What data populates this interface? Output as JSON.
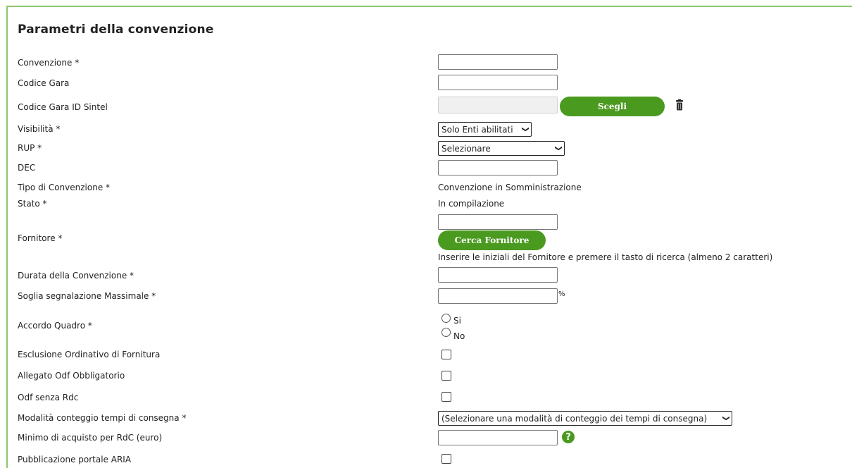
{
  "section": {
    "title": "Parametri della convenzione"
  },
  "labels": {
    "convenzione": "Convenzione *",
    "codice_gara": "Codice Gara",
    "codice_gara_sintel": "Codice Gara ID Sintel",
    "visibilita": "Visibilità *",
    "rup": "RUP *",
    "dec": "DEC",
    "tipo": "Tipo di Convenzione *",
    "stato": "Stato *",
    "fornitore": "Fornitore *",
    "durata": "Durata della Convenzione *",
    "soglia": "Soglia segnalazione Massimale *",
    "accordo": "Accordo Quadro *",
    "esclusione": "Esclusione Ordinativo di Fornitura",
    "allegato": "Allegato Odf Obbligatorio",
    "odf_rdc": "Odf senza Rdc",
    "modalita": "Modalità conteggio tempi di consegna *",
    "minimo": "Minimo di acquisto per RdC (euro)",
    "pubblicazione": "Pubblicazione portale ARIA"
  },
  "values": {
    "tipo": "Convenzione in Somministrazione",
    "stato": "In compilazione",
    "fornitore_hint": "Inserire le iniziali del Fornitore e premere il tasto di ricerca (almeno 2 caratteri)",
    "soglia_unit": "%"
  },
  "selects": {
    "visibilita": "Solo Enti abilitati",
    "rup": "Selezionare",
    "modalita": "(Selezionare una modalità di conteggio dei tempi di consegna)"
  },
  "buttons": {
    "scegli": "Scegli",
    "cerca_fornitore": "Cerca Fornitore"
  },
  "radios": {
    "si": "Si",
    "no": "No"
  },
  "help": "?"
}
